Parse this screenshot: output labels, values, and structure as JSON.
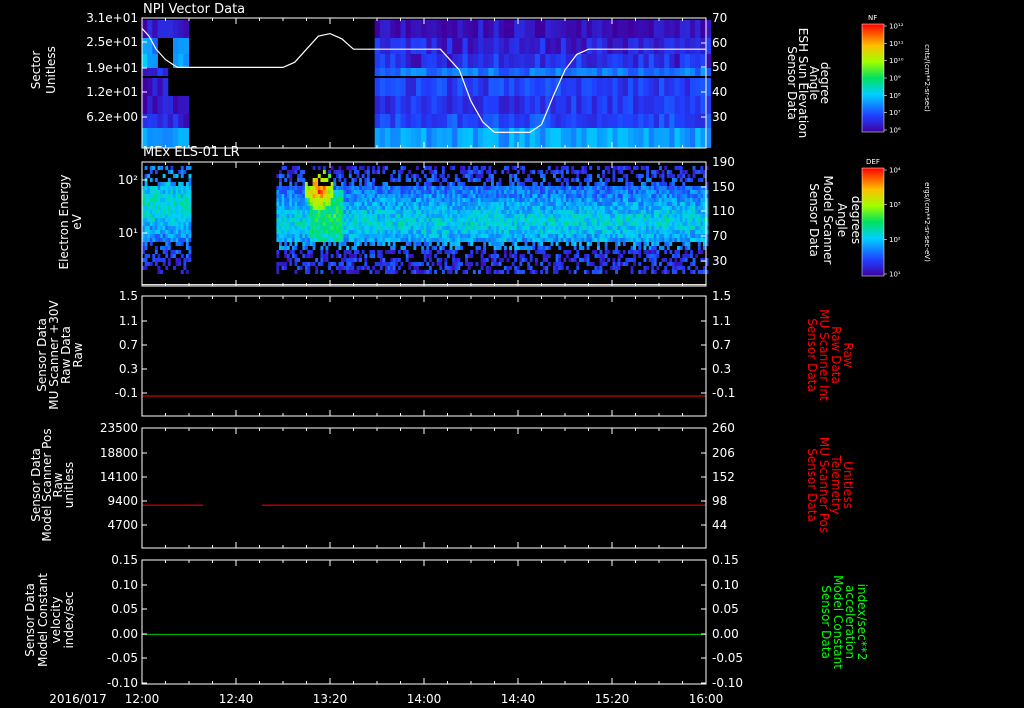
{
  "colors": {
    "background": "#000000",
    "axis": "#ffffff",
    "red_trace": "#ff0000",
    "green_trace": "#00cc00",
    "red_label": "#ff0000",
    "green_label": "#00ff00"
  },
  "footer": {
    "date": "2016/017"
  },
  "time_axis": {
    "ticks": [
      "12:00",
      "12:40",
      "13:20",
      "14:00",
      "14:40",
      "15:20",
      "16:00"
    ],
    "start_min": 0,
    "end_min": 240
  },
  "chart_data": [
    {
      "type": "heatmap",
      "title": "NPI Vector Data",
      "ylabel_lines": [
        "Sector",
        "Unitless"
      ],
      "yticks": [
        "3.1e+01",
        "2.5e+01",
        "1.9e+01",
        "1.2e+01",
        "6.2e+00"
      ],
      "right_ylabel_lines": [
        "Sensor Data",
        "ESH Sun Elevation",
        "Angle",
        "degree"
      ],
      "right_yticks": [
        "70",
        "60",
        "50",
        "40",
        "30"
      ],
      "right_ylim": [
        20,
        70
      ],
      "colorbar": {
        "label": "NF",
        "unit": "cnts/(cm**2-sr-sec)",
        "ticks": [
          "10¹²",
          "10¹¹",
          "10¹⁰",
          "10⁹",
          "10⁸",
          "10⁷",
          "10⁶"
        ]
      },
      "data_gaps_min": [
        [
          18,
          97
        ]
      ],
      "line_series": {
        "name": "ESH Sun Elevation Angle",
        "x_min": [
          0,
          3,
          6,
          10,
          15,
          20,
          30,
          40,
          50,
          60,
          65,
          70,
          75,
          80,
          85,
          90,
          95,
          100,
          106,
          110,
          115,
          120,
          127,
          135,
          140,
          145,
          150,
          155,
          160,
          165,
          170,
          175,
          180,
          185,
          190,
          200,
          220,
          240
        ],
        "values": [
          66,
          63,
          58,
          54,
          51,
          51,
          51,
          51,
          51,
          51,
          53,
          58,
          63,
          64,
          62,
          58,
          58,
          58,
          58,
          58,
          58,
          58,
          58,
          50,
          38,
          30,
          26,
          26,
          26,
          26,
          29,
          40,
          50,
          56,
          58,
          58,
          58,
          58
        ]
      }
    },
    {
      "type": "heatmap",
      "title": "MEx ELS-01 LR",
      "ylabel_lines": [
        "Electron Energy",
        "eV"
      ],
      "yticks": [
        "10²",
        "10¹"
      ],
      "right_ylabel_lines": [
        "Sensor Data",
        "Model Scanner",
        "Angle",
        "degrees"
      ],
      "right_yticks": [
        "190",
        "150",
        "110",
        "70",
        "30"
      ],
      "right_ylim": [
        10,
        190
      ],
      "colorbar": {
        "label": "DEF",
        "unit": "ergs/(cm**2-sr-sec-eV)",
        "ticks": [
          "10⁴",
          "10³",
          "10²",
          "10¹"
        ]
      },
      "data_gaps_min": [
        [
          20,
          57
        ]
      ],
      "burst_center_min": 75,
      "line_series": {
        "name": "Model Scanner Angle",
        "x_min": [
          0,
          240
        ],
        "values": [
          12,
          12
        ]
      }
    },
    {
      "type": "line",
      "ylabel_lines": [
        "Sensor Data",
        "MU Scanner +30V",
        "Raw Data",
        "Raw"
      ],
      "yticks": [
        "1.5",
        "1.1",
        "0.7",
        "0.3",
        "-0.1"
      ],
      "ylim": [
        -0.3,
        1.5
      ],
      "right_ylabel_lines": [
        "Sensor Data",
        "MU Scanner Int",
        "Raw Data",
        "Raw"
      ],
      "right_yticks": [
        "1.5",
        "1.1",
        "0.7",
        "0.3",
        "-0.1"
      ],
      "series": [
        {
          "x_min": [
            0,
            240
          ],
          "values": [
            0,
            0
          ]
        }
      ]
    },
    {
      "type": "line",
      "ylabel_lines": [
        "Sensor Data",
        "Model Scanner Pos",
        "Raw",
        "unitless"
      ],
      "yticks": [
        "23500",
        "18800",
        "14100",
        "9400",
        "4700"
      ],
      "ylim": [
        0,
        23500
      ],
      "right_ylabel_lines": [
        "Sensor Data",
        "MU Scanner Pos",
        "Telemetry",
        "Unitless"
      ],
      "right_yticks": [
        "260",
        "206",
        "152",
        "98",
        "44"
      ],
      "series": [
        {
          "segments_min": [
            [
              0,
              26
            ],
            [
              51,
              240
            ]
          ],
          "value": 8400
        }
      ]
    },
    {
      "type": "line",
      "ylabel_lines": [
        "Sensor Data",
        "Model Constant",
        "velocity",
        "index/sec"
      ],
      "yticks": [
        "0.15",
        "0.10",
        "0.05",
        "0.00",
        "-0.05",
        "-0.10"
      ],
      "ylim": [
        -0.1,
        0.15
      ],
      "right_ylabel_lines": [
        "Sensor Data",
        "Model Constant",
        "acceleration",
        "index/sec**2"
      ],
      "right_yticks": [
        "0.15",
        "0.10",
        "0.05",
        "0.00",
        "-0.05",
        "-0.10"
      ],
      "series": [
        {
          "x_min": [
            0,
            240
          ],
          "values": [
            0,
            0
          ]
        }
      ]
    }
  ]
}
